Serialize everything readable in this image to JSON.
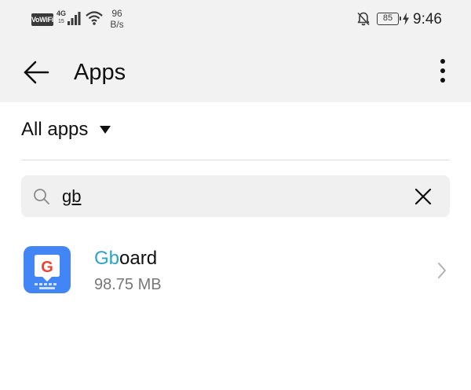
{
  "status_bar": {
    "vowifi": "VoWiFi",
    "network": "4G",
    "network_sub": "15",
    "speed_value": "96",
    "speed_unit": "B/s",
    "battery": "85",
    "time": "9:46",
    "icons": [
      "signal-icon",
      "wifi-icon",
      "bell-off-icon",
      "battery-icon",
      "charging-icon"
    ]
  },
  "app_bar": {
    "title": "Apps",
    "icons": [
      "back-arrow-icon",
      "more-vert-icon"
    ]
  },
  "filter": {
    "label": "All apps",
    "icon": "dropdown-triangle-icon"
  },
  "search": {
    "value": "gb",
    "icons": [
      "search-icon",
      "close-icon"
    ]
  },
  "apps": [
    {
      "name_highlight": "Gb",
      "name_rest": "oard",
      "size": "98.75 MB",
      "icon": "gboard-icon"
    }
  ],
  "colors": {
    "header_bg": "#f2f2f2",
    "search_bg": "#f0f0f0",
    "highlight": "#2aa4c9",
    "gboard_blue": "#4285f4",
    "secondary_text": "#777777"
  }
}
